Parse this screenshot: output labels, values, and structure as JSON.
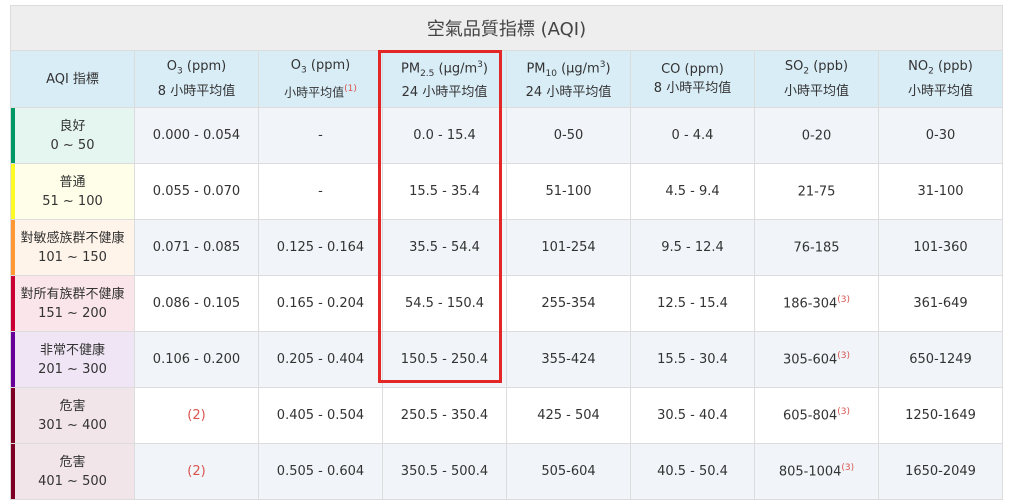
{
  "title": "空氣品質指標 (AQI)",
  "header": {
    "c0": "AQI 指標",
    "c1": {
      "main": "O",
      "sub": "3",
      "unit": " (ppm)",
      "period": "8 小時平均值"
    },
    "c2": {
      "main": "O",
      "sub": "3",
      "unit": " (ppm)",
      "period": "小時平均值",
      "note": "(1)"
    },
    "c3": {
      "main": "PM",
      "sub": "2.5",
      "unit": " (μg/m",
      "sup": "3",
      "close": ")",
      "period": "24 小時平均值"
    },
    "c4": {
      "main": "PM",
      "sub": "10",
      "unit": " (μg/m",
      "sup": "3",
      "close": ")",
      "period": "24 小時平均值"
    },
    "c5": {
      "main": "CO (ppm)",
      "period": "8 小時平均值"
    },
    "c6": {
      "main": "SO",
      "sub": "2",
      "unit": " (ppb)",
      "period": "小時平均值"
    },
    "c7": {
      "main": "NO",
      "sub": "2",
      "unit": " (ppb)",
      "period": "小時平均值"
    }
  },
  "colors": {
    "good": "#009865",
    "moderate": "#fffb26",
    "sensitive": "#ff9835",
    "unhealthy": "#ca0034",
    "very": "#670099",
    "hazard": "#7e0023",
    "good_bg": "#e5f5ef",
    "moderate_bg": "#ffffe9",
    "sensitive_bg": "#fff4ea",
    "unhealthy_bg": "#fae5ea",
    "very_bg": "#efe5f5",
    "hazard_bg": "#f2e5e9",
    "highlight": "#e32626"
  },
  "rows": [
    {
      "label": "良好",
      "range": "0 ~ 50",
      "o3_8h": "0.000 - 0.054",
      "o3_1h": "-",
      "pm25": "0.0 - 15.4",
      "pm10": "0-50",
      "co": "0 - 4.4",
      "so2": "0-20",
      "so2_note": "",
      "no2": "0-30"
    },
    {
      "label": "普通",
      "range": "51 ~ 100",
      "o3_8h": "0.055 - 0.070",
      "o3_1h": "-",
      "pm25": "15.5 - 35.4",
      "pm10": "51-100",
      "co": "4.5 - 9.4",
      "so2": "21-75",
      "so2_note": "",
      "no2": "31-100"
    },
    {
      "label": "對敏感族群不健康",
      "range": "101 ~ 150",
      "o3_8h": "0.071 - 0.085",
      "o3_1h": "0.125 - 0.164",
      "pm25": "35.5 - 54.4",
      "pm10": "101-254",
      "co": "9.5 - 12.4",
      "so2": "76-185",
      "so2_note": "",
      "no2": "101-360"
    },
    {
      "label": "對所有族群不健康",
      "range": "151 ~ 200",
      "o3_8h": "0.086 - 0.105",
      "o3_1h": "0.165 - 0.204",
      "pm25": "54.5 - 150.4",
      "pm10": "255-354",
      "co": "12.5 - 15.4",
      "so2": "186-304",
      "so2_note": "(3)",
      "no2": "361-649"
    },
    {
      "label": "非常不健康",
      "range": "201 ~ 300",
      "o3_8h": "0.106 - 0.200",
      "o3_1h": "0.205 - 0.404",
      "pm25": "150.5 - 250.4",
      "pm10": "355-424",
      "co": "15.5 - 30.4",
      "so2": "305-604",
      "so2_note": "(3)",
      "no2": "650-1249"
    },
    {
      "label": "危害",
      "range": "301 ~ 400",
      "o3_8h": "(2)",
      "o3_1h": "0.405 - 0.504",
      "pm25": "250.5 - 350.4",
      "pm10": "425 - 504",
      "co": "30.5 - 40.4",
      "so2": "605-804",
      "so2_note": "(3)",
      "no2": "1250-1649"
    },
    {
      "label": "危害",
      "range": "401 ~ 500",
      "o3_8h": "(2)",
      "o3_1h": "0.505 - 0.604",
      "pm25": "350.5 - 500.4",
      "pm10": "505-604",
      "co": "40.5 - 50.4",
      "so2": "805-1004",
      "so2_note": "(3)",
      "no2": "1650-2049"
    }
  ]
}
